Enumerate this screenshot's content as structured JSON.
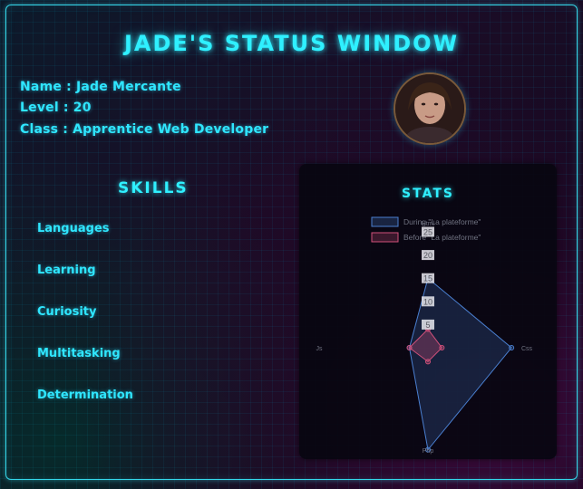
{
  "title": "JADE'S STATUS WINDOW",
  "profile": {
    "name": "Name : Jade Mercante",
    "level": "Level : 20",
    "class": "Class : Apprentice Web Developer"
  },
  "skills": {
    "heading": "SKILLS",
    "items": [
      "Languages",
      "Learning",
      "Curiosity",
      "Multitasking",
      "Determination"
    ]
  },
  "stats": {
    "heading": "STATS"
  },
  "colors": {
    "accent": "#2ff0ff",
    "during": "#4a7fd0",
    "before": "#d0507a"
  },
  "chart_data": {
    "type": "radar",
    "axes": [
      "Html",
      "Css",
      "Php",
      "Js"
    ],
    "scale_ticks": [
      5,
      10,
      15,
      20,
      25
    ],
    "range": [
      0,
      25
    ],
    "legend_position": "top",
    "series": [
      {
        "name": "During \"La plateforme\"",
        "values": [
          15,
          18,
          22,
          4
        ]
      },
      {
        "name": "Before \"La plateforme\"",
        "values": [
          4,
          3,
          3,
          4
        ]
      }
    ]
  }
}
